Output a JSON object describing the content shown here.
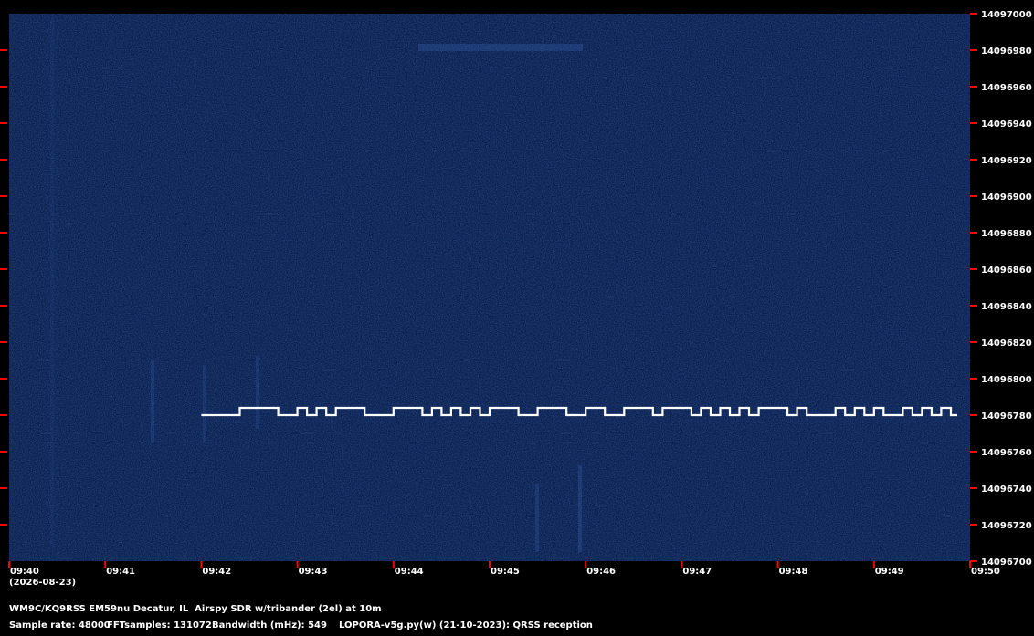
{
  "chart_data": {
    "type": "spectrogram",
    "x_ticks": [
      "09:40",
      "09:41",
      "09:42",
      "09:43",
      "09:44",
      "09:45",
      "09:46",
      "09:47",
      "09:48",
      "09:49",
      "09:50"
    ],
    "date_label": "(2026-08-23)",
    "y_ticks": [
      14096700,
      14096720,
      14096740,
      14096760,
      14096780,
      14096800,
      14096820,
      14096840,
      14096860,
      14096880,
      14096900,
      14096920,
      14096940,
      14096960,
      14096980,
      14097000
    ],
    "ylim": [
      14096700,
      14097000
    ],
    "signal": {
      "base_freq": 14096780,
      "shift_freq": 14096784,
      "time_start": "09:42:00",
      "time_end": "09:49:52",
      "high_segments": [
        [
          "09:42:24",
          "09:42:48"
        ],
        [
          "09:43:00",
          "09:43:06"
        ],
        [
          "09:43:12",
          "09:43:18"
        ],
        [
          "09:43:24",
          "09:43:42"
        ],
        [
          "09:44:00",
          "09:44:18"
        ],
        [
          "09:44:24",
          "09:44:30"
        ],
        [
          "09:44:36",
          "09:44:42"
        ],
        [
          "09:44:48",
          "09:44:54"
        ],
        [
          "09:45:00",
          "09:45:18"
        ],
        [
          "09:45:30",
          "09:45:48"
        ],
        [
          "09:46:00",
          "09:46:12"
        ],
        [
          "09:46:24",
          "09:46:42"
        ],
        [
          "09:46:48",
          "09:47:06"
        ],
        [
          "09:47:12",
          "09:47:18"
        ],
        [
          "09:47:24",
          "09:47:30"
        ],
        [
          "09:47:36",
          "09:47:42"
        ],
        [
          "09:47:48",
          "09:48:06"
        ],
        [
          "09:48:12",
          "09:48:18"
        ],
        [
          "09:48:36",
          "09:48:42"
        ],
        [
          "09:48:48",
          "09:48:54"
        ],
        [
          "09:49:00",
          "09:49:06"
        ],
        [
          "09:49:18",
          "09:49:24"
        ],
        [
          "09:49:30",
          "09:49:36"
        ],
        [
          "09:49:42",
          "09:49:48"
        ]
      ]
    },
    "colors": {
      "background": "#0b1f4e",
      "signal": "#ffffff",
      "tick": "#ff0000",
      "frame": "#000000"
    }
  },
  "footer": {
    "line1": "WM9C/KQ9RSS EM59nu Decatur, IL  Airspy SDR w/tribander (2el) at 10m",
    "sample_rate": "Sample rate: 48000",
    "fft": "FFTsamples: 131072",
    "bandwidth": "Bandwidth (mHz): 549",
    "software": "LOPORA-v5g.py(w) (21-10-2023): QRSS reception"
  }
}
